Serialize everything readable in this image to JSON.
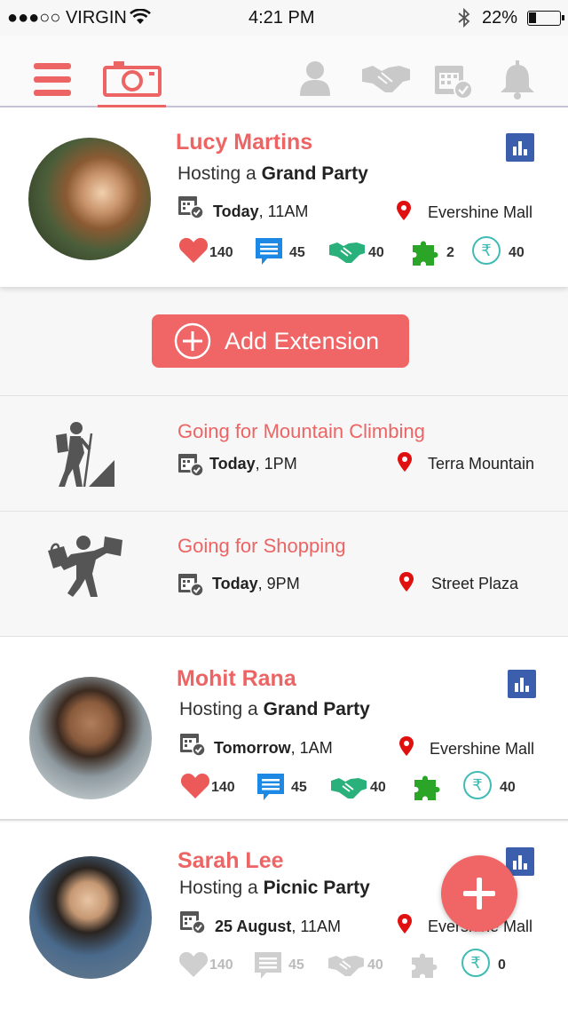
{
  "status_bar": {
    "carrier": "●●●○○ VIRGIN",
    "time": "4:21 PM",
    "battery": "22%"
  },
  "nav": {
    "icons": [
      "menu-icon",
      "camera-icon",
      "person-icon",
      "handshake-icon",
      "calendar-check-icon",
      "bell-icon"
    ],
    "active": "camera-icon"
  },
  "colors": {
    "accent": "#ec6464",
    "chip_blue": "#3b5fac",
    "comment_blue": "#1e88e5",
    "handshake_green": "#2ab07a",
    "puzzle_green": "#2aa527",
    "rupee_teal": "#3fbcb4"
  },
  "feed": [
    {
      "name": "Lucy Martins",
      "hosting_prefix": "Hosting a ",
      "event": "Grand Party",
      "day": "Today",
      "time": ", 11AM",
      "venue": "Evershine Mall",
      "likes": "140",
      "comments": "45",
      "handshakes": "40",
      "puzzles": "2",
      "rupees": "40"
    },
    {
      "name": "Mohit Rana",
      "hosting_prefix": "Hosting a ",
      "event": "Grand Party",
      "day": "Tomorrow",
      "time": ", 1AM",
      "venue": "Evershine Mall",
      "likes": "140",
      "comments": "45",
      "handshakes": "40",
      "puzzles": "",
      "rupees": "40"
    },
    {
      "name": "Sarah Lee",
      "hosting_prefix": "Hosting a ",
      "event": "Picnic Party",
      "day": "25 August",
      "time": ", 11AM",
      "venue": "Evershine Mall",
      "likes": "140",
      "comments": "45",
      "handshakes": "40",
      "puzzles": "",
      "rupees": "0"
    }
  ],
  "add_extension": {
    "label": "Add Extension"
  },
  "extensions": [
    {
      "title": "Going for Mountain Climbing",
      "day": "Today",
      "time": ", 1PM",
      "venue": "Terra Mountain",
      "icon": "hiker-icon"
    },
    {
      "title": "Going for Shopping",
      "day": "Today",
      "time": ", 9PM",
      "venue": "Street Plaza",
      "icon": "shopper-icon"
    }
  ],
  "fab": {
    "icon": "plus-icon"
  }
}
